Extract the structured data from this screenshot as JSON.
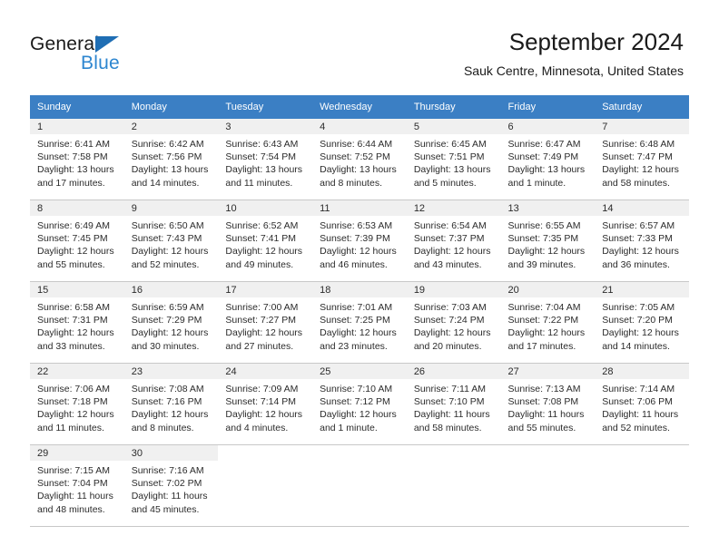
{
  "logo": {
    "word1": "General",
    "word2": "Blue",
    "triangle_color": "#1f6eb4",
    "blue_color": "#2d86d0"
  },
  "header": {
    "title": "September 2024",
    "subtitle": "Sauk Centre, Minnesota, United States",
    "header_bg": "#3b7fc4",
    "daynum_bg": "#f0f0f0"
  },
  "weekday_headers": [
    "Sunday",
    "Monday",
    "Tuesday",
    "Wednesday",
    "Thursday",
    "Friday",
    "Saturday"
  ],
  "weeks": [
    [
      {
        "day": "1",
        "sunrise": "Sunrise: 6:41 AM",
        "sunset": "Sunset: 7:58 PM",
        "daylight1": "Daylight: 13 hours",
        "daylight2": "and 17 minutes."
      },
      {
        "day": "2",
        "sunrise": "Sunrise: 6:42 AM",
        "sunset": "Sunset: 7:56 PM",
        "daylight1": "Daylight: 13 hours",
        "daylight2": "and 14 minutes."
      },
      {
        "day": "3",
        "sunrise": "Sunrise: 6:43 AM",
        "sunset": "Sunset: 7:54 PM",
        "daylight1": "Daylight: 13 hours",
        "daylight2": "and 11 minutes."
      },
      {
        "day": "4",
        "sunrise": "Sunrise: 6:44 AM",
        "sunset": "Sunset: 7:52 PM",
        "daylight1": "Daylight: 13 hours",
        "daylight2": "and 8 minutes."
      },
      {
        "day": "5",
        "sunrise": "Sunrise: 6:45 AM",
        "sunset": "Sunset: 7:51 PM",
        "daylight1": "Daylight: 13 hours",
        "daylight2": "and 5 minutes."
      },
      {
        "day": "6",
        "sunrise": "Sunrise: 6:47 AM",
        "sunset": "Sunset: 7:49 PM",
        "daylight1": "Daylight: 13 hours",
        "daylight2": "and 1 minute."
      },
      {
        "day": "7",
        "sunrise": "Sunrise: 6:48 AM",
        "sunset": "Sunset: 7:47 PM",
        "daylight1": "Daylight: 12 hours",
        "daylight2": "and 58 minutes."
      }
    ],
    [
      {
        "day": "8",
        "sunrise": "Sunrise: 6:49 AM",
        "sunset": "Sunset: 7:45 PM",
        "daylight1": "Daylight: 12 hours",
        "daylight2": "and 55 minutes."
      },
      {
        "day": "9",
        "sunrise": "Sunrise: 6:50 AM",
        "sunset": "Sunset: 7:43 PM",
        "daylight1": "Daylight: 12 hours",
        "daylight2": "and 52 minutes."
      },
      {
        "day": "10",
        "sunrise": "Sunrise: 6:52 AM",
        "sunset": "Sunset: 7:41 PM",
        "daylight1": "Daylight: 12 hours",
        "daylight2": "and 49 minutes."
      },
      {
        "day": "11",
        "sunrise": "Sunrise: 6:53 AM",
        "sunset": "Sunset: 7:39 PM",
        "daylight1": "Daylight: 12 hours",
        "daylight2": "and 46 minutes."
      },
      {
        "day": "12",
        "sunrise": "Sunrise: 6:54 AM",
        "sunset": "Sunset: 7:37 PM",
        "daylight1": "Daylight: 12 hours",
        "daylight2": "and 43 minutes."
      },
      {
        "day": "13",
        "sunrise": "Sunrise: 6:55 AM",
        "sunset": "Sunset: 7:35 PM",
        "daylight1": "Daylight: 12 hours",
        "daylight2": "and 39 minutes."
      },
      {
        "day": "14",
        "sunrise": "Sunrise: 6:57 AM",
        "sunset": "Sunset: 7:33 PM",
        "daylight1": "Daylight: 12 hours",
        "daylight2": "and 36 minutes."
      }
    ],
    [
      {
        "day": "15",
        "sunrise": "Sunrise: 6:58 AM",
        "sunset": "Sunset: 7:31 PM",
        "daylight1": "Daylight: 12 hours",
        "daylight2": "and 33 minutes."
      },
      {
        "day": "16",
        "sunrise": "Sunrise: 6:59 AM",
        "sunset": "Sunset: 7:29 PM",
        "daylight1": "Daylight: 12 hours",
        "daylight2": "and 30 minutes."
      },
      {
        "day": "17",
        "sunrise": "Sunrise: 7:00 AM",
        "sunset": "Sunset: 7:27 PM",
        "daylight1": "Daylight: 12 hours",
        "daylight2": "and 27 minutes."
      },
      {
        "day": "18",
        "sunrise": "Sunrise: 7:01 AM",
        "sunset": "Sunset: 7:25 PM",
        "daylight1": "Daylight: 12 hours",
        "daylight2": "and 23 minutes."
      },
      {
        "day": "19",
        "sunrise": "Sunrise: 7:03 AM",
        "sunset": "Sunset: 7:24 PM",
        "daylight1": "Daylight: 12 hours",
        "daylight2": "and 20 minutes."
      },
      {
        "day": "20",
        "sunrise": "Sunrise: 7:04 AM",
        "sunset": "Sunset: 7:22 PM",
        "daylight1": "Daylight: 12 hours",
        "daylight2": "and 17 minutes."
      },
      {
        "day": "21",
        "sunrise": "Sunrise: 7:05 AM",
        "sunset": "Sunset: 7:20 PM",
        "daylight1": "Daylight: 12 hours",
        "daylight2": "and 14 minutes."
      }
    ],
    [
      {
        "day": "22",
        "sunrise": "Sunrise: 7:06 AM",
        "sunset": "Sunset: 7:18 PM",
        "daylight1": "Daylight: 12 hours",
        "daylight2": "and 11 minutes."
      },
      {
        "day": "23",
        "sunrise": "Sunrise: 7:08 AM",
        "sunset": "Sunset: 7:16 PM",
        "daylight1": "Daylight: 12 hours",
        "daylight2": "and 8 minutes."
      },
      {
        "day": "24",
        "sunrise": "Sunrise: 7:09 AM",
        "sunset": "Sunset: 7:14 PM",
        "daylight1": "Daylight: 12 hours",
        "daylight2": "and 4 minutes."
      },
      {
        "day": "25",
        "sunrise": "Sunrise: 7:10 AM",
        "sunset": "Sunset: 7:12 PM",
        "daylight1": "Daylight: 12 hours",
        "daylight2": "and 1 minute."
      },
      {
        "day": "26",
        "sunrise": "Sunrise: 7:11 AM",
        "sunset": "Sunset: 7:10 PM",
        "daylight1": "Daylight: 11 hours",
        "daylight2": "and 58 minutes."
      },
      {
        "day": "27",
        "sunrise": "Sunrise: 7:13 AM",
        "sunset": "Sunset: 7:08 PM",
        "daylight1": "Daylight: 11 hours",
        "daylight2": "and 55 minutes."
      },
      {
        "day": "28",
        "sunrise": "Sunrise: 7:14 AM",
        "sunset": "Sunset: 7:06 PM",
        "daylight1": "Daylight: 11 hours",
        "daylight2": "and 52 minutes."
      }
    ],
    [
      {
        "day": "29",
        "sunrise": "Sunrise: 7:15 AM",
        "sunset": "Sunset: 7:04 PM",
        "daylight1": "Daylight: 11 hours",
        "daylight2": "and 48 minutes."
      },
      {
        "day": "30",
        "sunrise": "Sunrise: 7:16 AM",
        "sunset": "Sunset: 7:02 PM",
        "daylight1": "Daylight: 11 hours",
        "daylight2": "and 45 minutes."
      },
      {
        "day": "",
        "sunrise": "",
        "sunset": "",
        "daylight1": "",
        "daylight2": ""
      },
      {
        "day": "",
        "sunrise": "",
        "sunset": "",
        "daylight1": "",
        "daylight2": ""
      },
      {
        "day": "",
        "sunrise": "",
        "sunset": "",
        "daylight1": "",
        "daylight2": ""
      },
      {
        "day": "",
        "sunrise": "",
        "sunset": "",
        "daylight1": "",
        "daylight2": ""
      },
      {
        "day": "",
        "sunrise": "",
        "sunset": "",
        "daylight1": "",
        "daylight2": ""
      }
    ]
  ]
}
